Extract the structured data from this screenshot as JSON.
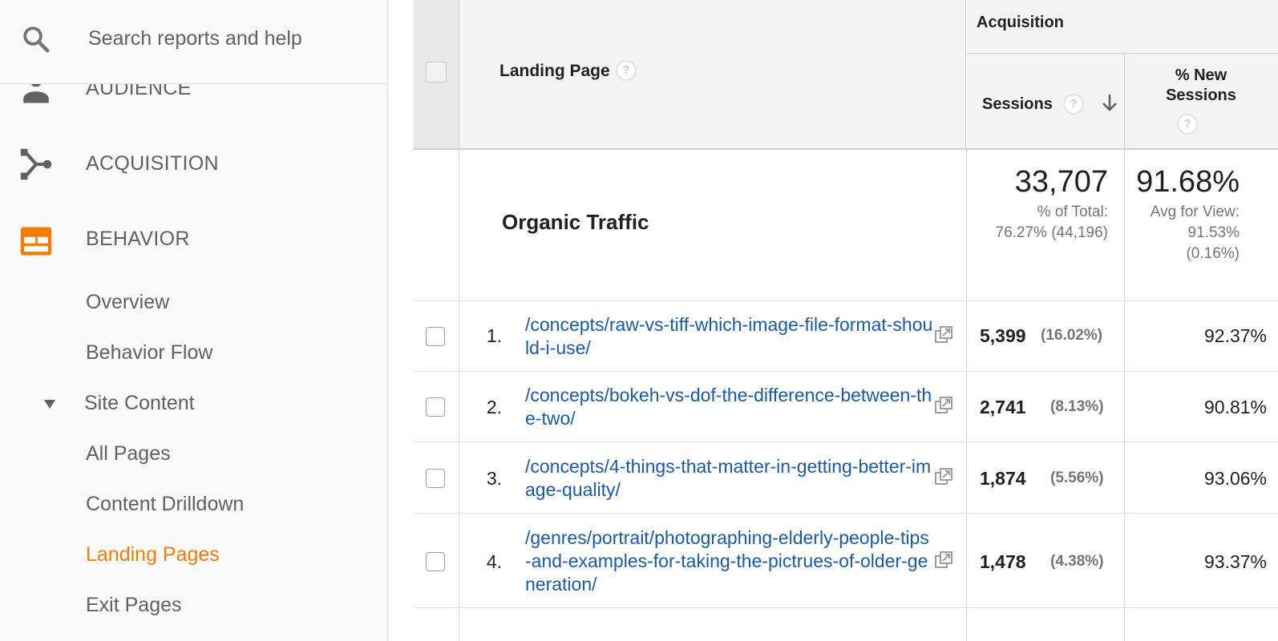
{
  "sidebar": {
    "search_placeholder": "Search reports and help",
    "sections": [
      {
        "label": "AUDIENCE",
        "icon": "person-icon"
      },
      {
        "label": "ACQUISITION",
        "icon": "acquisition-icon"
      },
      {
        "label": "BEHAVIOR",
        "icon": "behavior-icon"
      }
    ],
    "behavior_items": {
      "overview": "Overview",
      "behavior_flow": "Behavior Flow",
      "site_content": "Site Content",
      "all_pages": "All Pages",
      "content_drilldown": "Content Drilldown",
      "landing_pages": "Landing Pages",
      "exit_pages": "Exit Pages"
    },
    "accent_color": "#f57c00"
  },
  "table": {
    "headers": {
      "landing_page": "Landing Page",
      "acquisition": "Acquisition",
      "sessions": "Sessions",
      "new_sessions_line1": "% New",
      "new_sessions_line2": "Sessions",
      "help": "?"
    },
    "summary": {
      "label": "Organic Traffic",
      "sessions": "33,707",
      "sessions_sub1": "% of Total:",
      "sessions_sub2": "76.27% (44,196)",
      "new_sessions": "91.68%",
      "new_sub1": "Avg for View:",
      "new_sub2": "91.53%",
      "new_sub3": "(0.16%)"
    },
    "rows": [
      {
        "num": "1.",
        "page": "/concepts/raw-vs-tiff-which-image-file-format-should-i-use/",
        "sessions": "5,399",
        "pct": "(16.02%)",
        "new_sessions": "92.37%"
      },
      {
        "num": "2.",
        "page": "/concepts/bokeh-vs-dof-the-difference-between-the-two/",
        "sessions": "2,741",
        "pct": "(8.13%)",
        "new_sessions": "90.81%"
      },
      {
        "num": "3.",
        "page": "/concepts/4-things-that-matter-in-getting-better-image-quality/",
        "sessions": "1,874",
        "pct": "(5.56%)",
        "new_sessions": "93.06%"
      },
      {
        "num": "4.",
        "page": "/genres/portrait/photographing-elderly-people-tips-and-examples-for-taking-the-pictrues-of-older-generation/",
        "sessions": "1,478",
        "pct": "(4.38%)",
        "new_sessions": "93.37%"
      }
    ],
    "link_color": "#1a5aa6"
  }
}
